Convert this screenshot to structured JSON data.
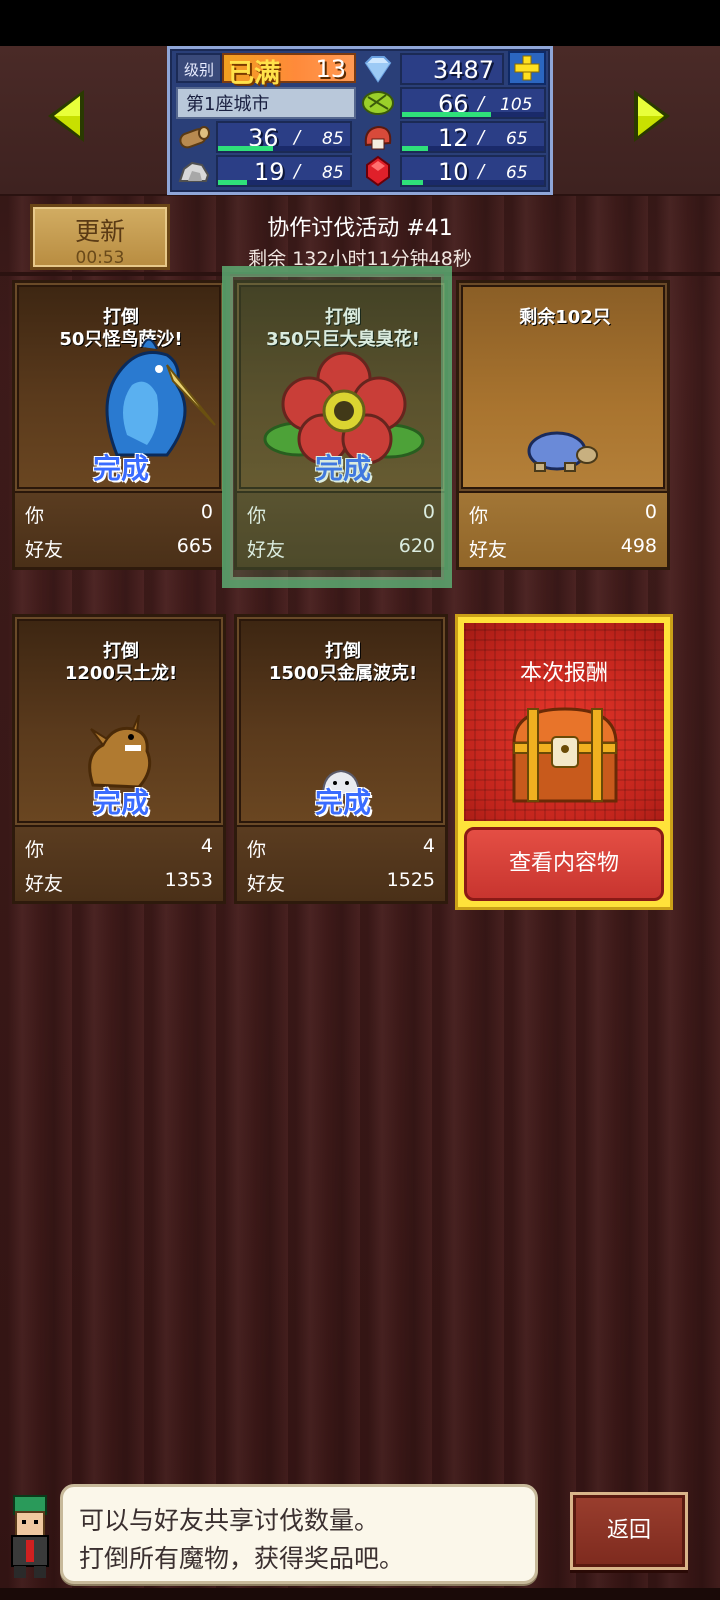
{
  "resources": {
    "level_label": "级别",
    "level_max": "已满",
    "level_num": "13",
    "gems": "3487",
    "city": "第1座城市",
    "food": {
      "value": "66",
      "max": "105",
      "fill": 0.63
    },
    "wood": {
      "value": "36",
      "max": "85",
      "fill": 0.42
    },
    "meat": {
      "value": "12",
      "max": "65",
      "fill": 0.18
    },
    "stone": {
      "value": "19",
      "max": "85",
      "fill": 0.22
    },
    "ruby": {
      "value": "10",
      "max": "65",
      "fill": 0.15
    }
  },
  "refresh": {
    "label": "更新",
    "time": "00:53"
  },
  "event": {
    "title": "协作讨伐活动 #41",
    "remaining": "剩余 132小时11分钟48秒"
  },
  "labels": {
    "you": "你",
    "friends": "好友",
    "done": "完成"
  },
  "cards": [
    {
      "title1": "打倒",
      "title2": "50只怪鸟萨沙!",
      "done": true,
      "you": "0",
      "friends": "665",
      "creature": "blue-bird-monster"
    },
    {
      "title1": "打倒",
      "title2": "350只巨大臭臭花!",
      "done": true,
      "you": "0",
      "friends": "620",
      "creature": "giant-flower-monster"
    },
    {
      "title1": "剩余102只",
      "title2": "",
      "done": false,
      "you": "0",
      "friends": "498",
      "creature": "blue-turtle-monster"
    },
    {
      "title1": "打倒",
      "title2": "1200只土龙!",
      "done": true,
      "you": "4",
      "friends": "1353",
      "creature": "earth-dragon-monster"
    },
    {
      "title1": "打倒",
      "title2": "1500只金属波克!",
      "done": true,
      "you": "4",
      "friends": "1525",
      "creature": "metal-slime-monster"
    }
  ],
  "reward": {
    "title": "本次报酬",
    "button": "查看内容物"
  },
  "hint": {
    "line1": "可以与好友共享讨伐数量。",
    "line2": "打倒所有魔物，获得奖品吧。"
  },
  "back_label": "返回",
  "colors": {
    "done_text": "#3a6cff",
    "progress_bar": "#2fe07a",
    "reward_frame": "#ffe23a"
  }
}
